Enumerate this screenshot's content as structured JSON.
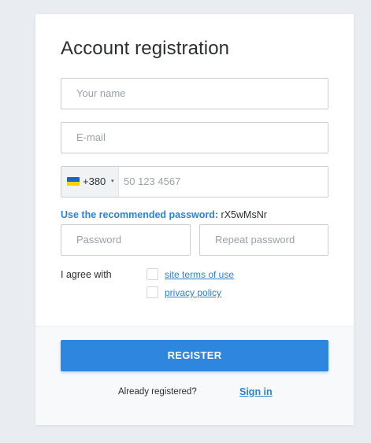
{
  "form": {
    "title": "Account registration",
    "name_placeholder": "Your name",
    "email_placeholder": "E-mail",
    "phone": {
      "country_code": "+380",
      "caret": "▾",
      "placeholder": "50 123 4567",
      "flag_colors": [
        "#1d64c8",
        "#f5d400"
      ]
    },
    "recommended_label": "Use the recommended password:",
    "recommended_password": "rX5wMsNr",
    "password_placeholder": "Password",
    "repeat_password_placeholder": "Repeat password",
    "agree_label": "I agree with",
    "terms_link": "site terms of use",
    "privacy_link": "privacy policy"
  },
  "footer": {
    "register_label": "REGISTER",
    "already_text": "Already registered?",
    "signin_link": "Sign in"
  },
  "colors": {
    "accent": "#2e86de",
    "link": "#2b82d8",
    "background": "#e9ecf0"
  }
}
